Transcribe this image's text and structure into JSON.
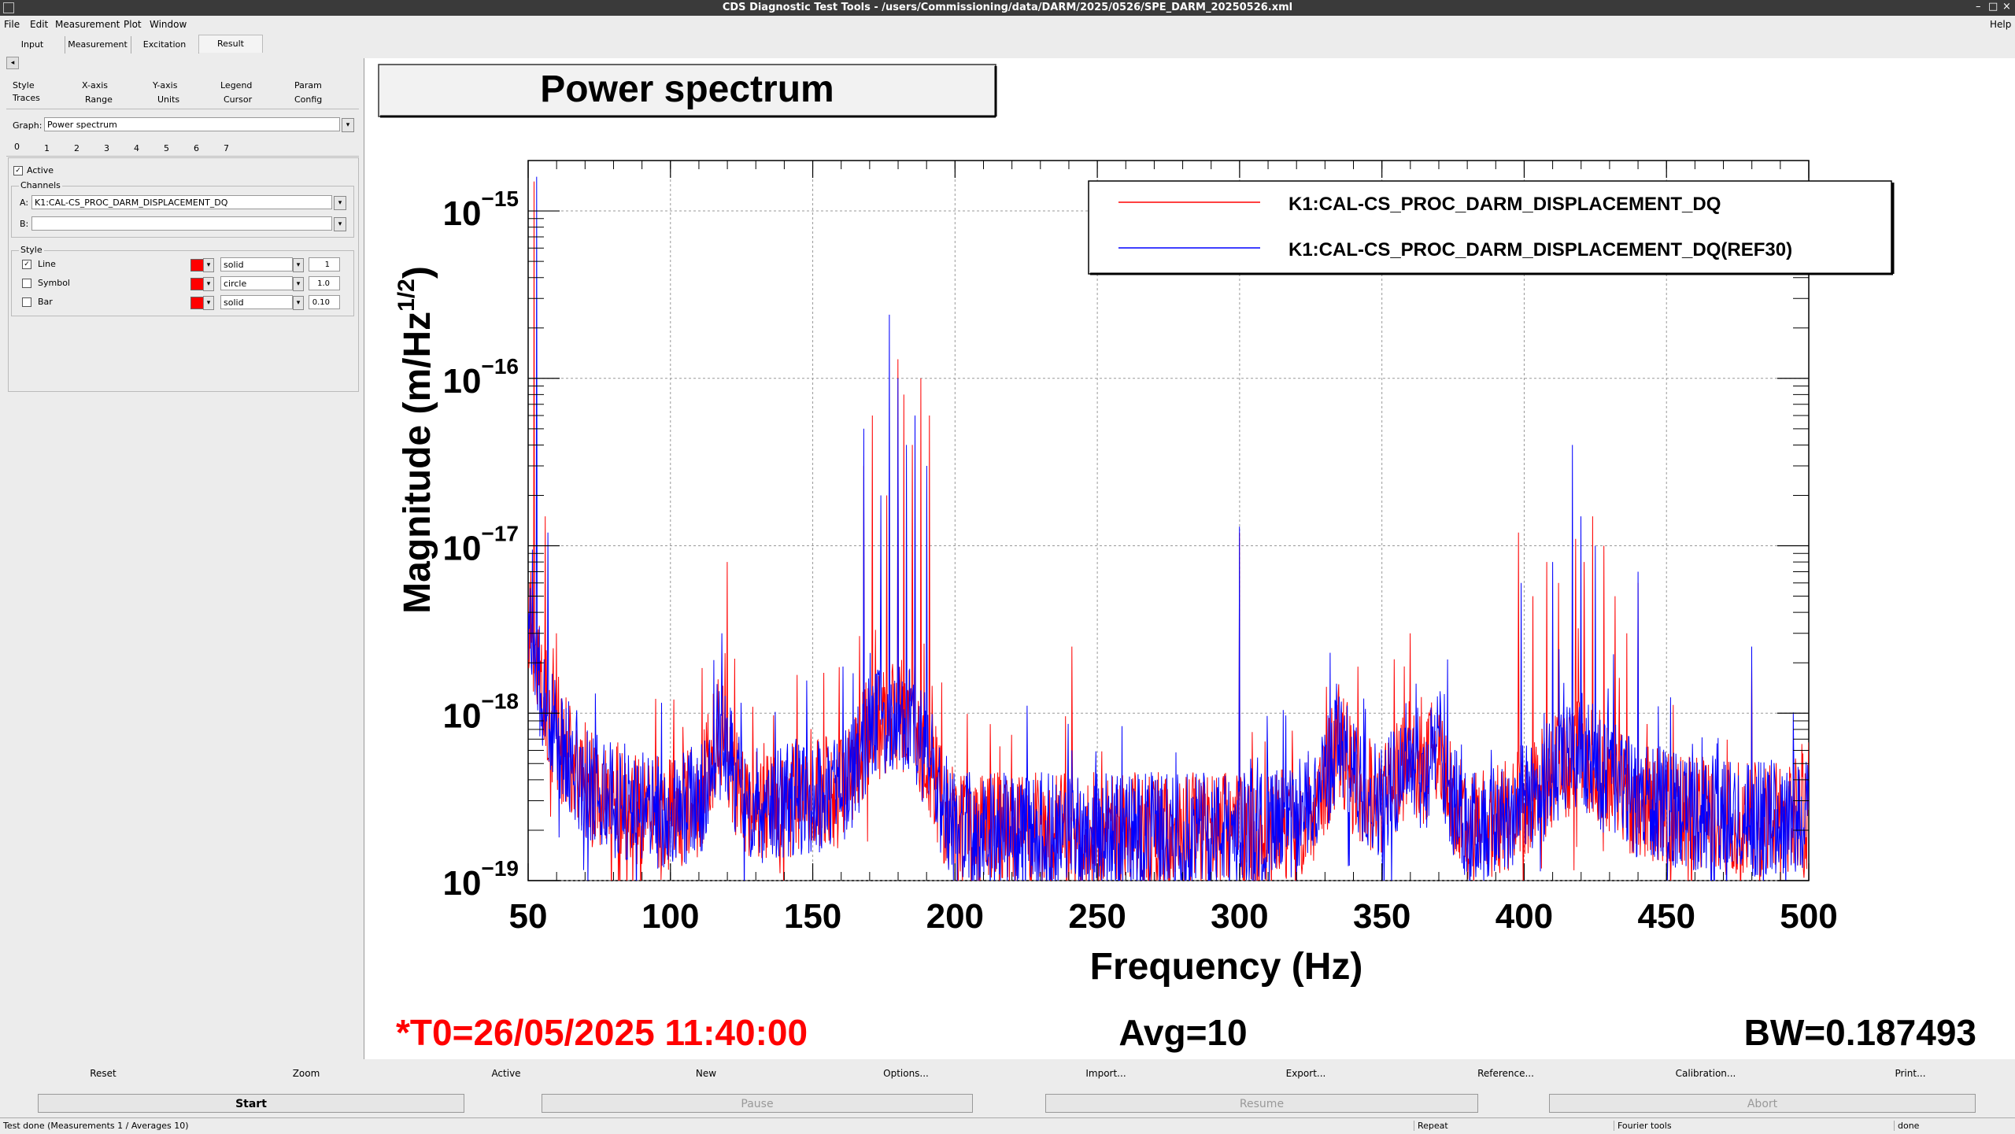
{
  "window": {
    "title": "CDS Diagnostic Test Tools - /users/Commissioning/data/DARM/2025/0526/SPE_DARM_20250526.xml",
    "minimize": "–",
    "maximize": "□",
    "close": "×"
  },
  "menubar": {
    "items": [
      "File",
      "Edit",
      "Measurement",
      "Plot",
      "Window"
    ],
    "help": "Help"
  },
  "tabs": [
    "Input",
    "Measurement",
    "Excitation",
    "Result"
  ],
  "active_tab": "Result",
  "collapse_arrow": "◂",
  "options_tabs": {
    "row1": [
      "Style",
      "X-axis",
      "Y-axis",
      "Legend",
      "Param"
    ],
    "row2": [
      "Traces",
      "Range",
      "Units",
      "Cursor",
      "Config"
    ]
  },
  "graph": {
    "label": "Graph:",
    "value": "Power spectrum"
  },
  "trace_numbers": [
    "0",
    "1",
    "2",
    "3",
    "4",
    "5",
    "6",
    "7"
  ],
  "active": {
    "label": "Active",
    "checked": true
  },
  "channels": {
    "title": "Channels",
    "a_label": "A:",
    "a_value": "K1:CAL-CS_PROC_DARM_DISPLACEMENT_DQ",
    "b_label": "B:",
    "b_value": ""
  },
  "style": {
    "title": "Style",
    "rows": [
      {
        "label": "Line",
        "checked": true,
        "color": "#ff0000",
        "pattern": "solid",
        "size": "1"
      },
      {
        "label": "Symbol",
        "checked": false,
        "color": "#ff0000",
        "pattern": "circle",
        "size": "1.0"
      },
      {
        "label": "Bar",
        "checked": false,
        "color": "#ff0000",
        "pattern": "solid",
        "size": "0.10"
      }
    ]
  },
  "plot": {
    "title": "Power spectrum",
    "t0": "*T0=26/05/2025 11:40:00",
    "avg": "Avg=10",
    "bw": "BW=0.187493",
    "t0_color": "#ff0000"
  },
  "chart_data": {
    "type": "line",
    "xlabel": "Frequency (Hz)",
    "ylabel": "Magnitude (m/Hz^1/2)",
    "xlim": [
      50,
      500
    ],
    "ylim": [
      1e-19,
      2e-15
    ],
    "yscale": "log",
    "grid": true,
    "legend_position": "top-right",
    "x_ticks": [
      50,
      100,
      150,
      200,
      250,
      300,
      350,
      400,
      450,
      500
    ],
    "y_ticks": [
      {
        "mantissa": "10",
        "exponent": "−19"
      },
      {
        "mantissa": "10",
        "exponent": "−18"
      },
      {
        "mantissa": "10",
        "exponent": "−17"
      },
      {
        "mantissa": "10",
        "exponent": "−16"
      },
      {
        "mantissa": "10",
        "exponent": "−15"
      }
    ],
    "baseline_points": [
      [
        50,
        3e-18
      ],
      [
        55,
        1.3e-18
      ],
      [
        60,
        7e-19
      ],
      [
        70,
        4e-19
      ],
      [
        80,
        3e-19
      ],
      [
        90,
        2.7e-19
      ],
      [
        100,
        2.5e-19
      ],
      [
        110,
        3e-19
      ],
      [
        117,
        8e-19
      ],
      [
        125,
        3e-19
      ],
      [
        140,
        3e-19
      ],
      [
        150,
        3.2e-19
      ],
      [
        160,
        3.5e-19
      ],
      [
        165,
        5e-19
      ],
      [
        170,
        8e-19
      ],
      [
        180,
        1e-18
      ],
      [
        185,
        8e-19
      ],
      [
        190,
        6e-19
      ],
      [
        195,
        3e-19
      ],
      [
        200,
        2e-19
      ],
      [
        220,
        2e-19
      ],
      [
        250,
        2e-19
      ],
      [
        280,
        2e-19
      ],
      [
        300,
        2e-19
      ],
      [
        320,
        2.1e-19
      ],
      [
        330,
        4e-19
      ],
      [
        335,
        7e-19
      ],
      [
        340,
        4e-19
      ],
      [
        350,
        3e-19
      ],
      [
        360,
        6e-19
      ],
      [
        365,
        4e-19
      ],
      [
        370,
        7e-19
      ],
      [
        375,
        3e-19
      ],
      [
        380,
        2e-19
      ],
      [
        390,
        2.2e-19
      ],
      [
        400,
        3e-19
      ],
      [
        420,
        6e-19
      ],
      [
        440,
        3e-19
      ],
      [
        460,
        2.5e-19
      ],
      [
        480,
        2.3e-19
      ],
      [
        500,
        2.5e-19
      ]
    ],
    "series": [
      {
        "name": "K1:CAL-CS_PROC_DARM_DISPLACEMENT_DQ",
        "color": "#ff0000",
        "peaks": [
          [
            52,
            1.5e-15
          ],
          [
            56,
            1.5e-17
          ],
          [
            60,
            3e-18
          ],
          [
            120,
            8e-18
          ],
          [
            168,
            3e-17
          ],
          [
            171,
            6e-17
          ],
          [
            176,
            2e-17
          ],
          [
            180,
            1.3e-16
          ],
          [
            182,
            8e-17
          ],
          [
            185,
            4e-17
          ],
          [
            188,
            1e-16
          ],
          [
            191,
            6e-17
          ],
          [
            241,
            2.5e-18
          ],
          [
            300,
            1.2e-17
          ],
          [
            360,
            3e-18
          ],
          [
            398,
            1.2e-17
          ],
          [
            403,
            5e-18
          ],
          [
            408,
            8e-18
          ],
          [
            412,
            6e-18
          ],
          [
            418,
            1.1e-17
          ],
          [
            421,
            8e-18
          ],
          [
            424,
            1.5e-17
          ],
          [
            428,
            1e-17
          ],
          [
            432,
            5e-18
          ],
          [
            436,
            3e-18
          ],
          [
            440,
            6e-18
          ],
          [
            480,
            2e-18
          ]
        ]
      },
      {
        "name": "K1:CAL-CS_PROC_DARM_DISPLACEMENT_DQ(REF30)",
        "color": "#0000ff",
        "peaks": [
          [
            53,
            1.6e-15
          ],
          [
            57,
            1.2e-17
          ],
          [
            118,
            3e-18
          ],
          [
            168,
            5e-17
          ],
          [
            174,
            2e-17
          ],
          [
            177,
            2.4e-16
          ],
          [
            180,
            1e-16
          ],
          [
            183,
            4e-17
          ],
          [
            186,
            6e-17
          ],
          [
            190,
            3e-17
          ],
          [
            241,
            6e-19
          ],
          [
            300,
            1.3e-17
          ],
          [
            334,
            1.5e-18
          ],
          [
            362,
            1.5e-18
          ],
          [
            372,
            1.3e-18
          ],
          [
            399,
            6e-18
          ],
          [
            410,
            8e-18
          ],
          [
            417,
            4e-17
          ],
          [
            420,
            1.5e-17
          ],
          [
            425,
            1e-17
          ],
          [
            440,
            7e-18
          ],
          [
            480,
            2.5e-18
          ]
        ]
      }
    ]
  },
  "bottom_buttons": [
    "Reset",
    "Zoom",
    "Active",
    "New",
    "Options...",
    "Import...",
    "Export...",
    "Reference...",
    "Calibration...",
    "Print..."
  ],
  "control_buttons": [
    {
      "label": "Start",
      "enabled": true
    },
    {
      "label": "Pause",
      "enabled": false
    },
    {
      "label": "Resume",
      "enabled": false
    },
    {
      "label": "Abort",
      "enabled": false
    }
  ],
  "status": {
    "left": "Test done (Measurements 1 / Averages 10)",
    "repeat": "Repeat",
    "tools": "Fourier tools",
    "done": "done"
  }
}
